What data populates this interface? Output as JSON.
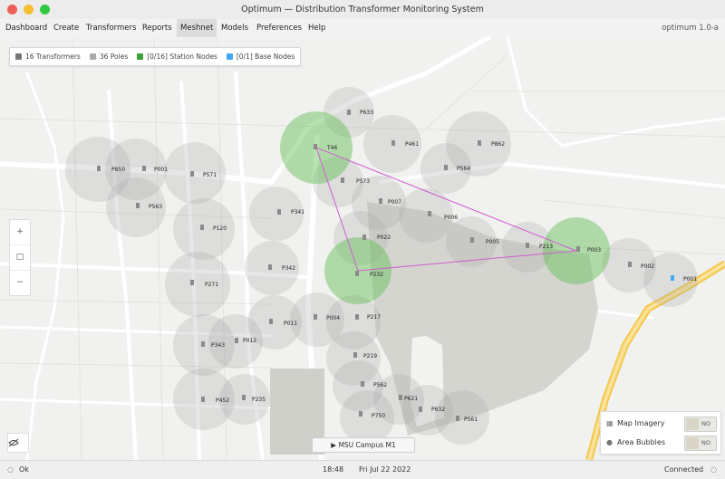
{
  "window": {
    "title": "Optimum — Distribution Transformer Monitoring System"
  },
  "menu": {
    "items": [
      {
        "label": "Dashboard"
      },
      {
        "label": "Create"
      },
      {
        "label": "Transformers"
      },
      {
        "label": "Reports"
      },
      {
        "label": "Meshnet"
      },
      {
        "label": "Models"
      },
      {
        "label": "Preferences"
      },
      {
        "label": "Help"
      }
    ],
    "active": "Meshnet",
    "version": "optimum 1.0-a"
  },
  "legend": {
    "transformers": "16 Transformers",
    "poles": "36 Poles",
    "station_nodes": "[0/16] Station Nodes",
    "base_nodes": "[0/1] Base Nodes",
    "colors": {
      "transformers": "#777777",
      "poles": "#aaaaaa",
      "station_nodes": "#3aa23a",
      "base_nodes": "#3fa9f5"
    }
  },
  "zoom": {
    "in": "+",
    "reset": "□",
    "out": "−"
  },
  "map": {
    "campus_label": "MSU Campus M1",
    "poles": [
      {
        "id": "P633"
      },
      {
        "id": "T46"
      },
      {
        "id": "P461"
      },
      {
        "id": "P862"
      },
      {
        "id": "P564"
      },
      {
        "id": "P850"
      },
      {
        "id": "P001"
      },
      {
        "id": "P571"
      },
      {
        "id": "P573"
      },
      {
        "id": "P563"
      },
      {
        "id": "P341"
      },
      {
        "id": "P007"
      },
      {
        "id": "P006"
      },
      {
        "id": "P120"
      },
      {
        "id": "P022"
      },
      {
        "id": "P005"
      },
      {
        "id": "P213"
      },
      {
        "id": "P003"
      },
      {
        "id": "P342"
      },
      {
        "id": "P232"
      },
      {
        "id": "P002"
      },
      {
        "id": "P001"
      },
      {
        "id": "P271"
      },
      {
        "id": "P011"
      },
      {
        "id": "P004"
      },
      {
        "id": "P217"
      },
      {
        "id": "P343"
      },
      {
        "id": "P012"
      },
      {
        "id": "P219"
      },
      {
        "id": "P562"
      },
      {
        "id": "P452"
      },
      {
        "id": "P235"
      },
      {
        "id": "P621"
      },
      {
        "id": "P632"
      },
      {
        "id": "P750"
      },
      {
        "id": "P561"
      }
    ]
  },
  "panel": {
    "map_imagery": {
      "label": "Map Imagery",
      "value": "NO"
    },
    "area_bubbles": {
      "label": "Area Bubbles",
      "value": "NO"
    }
  },
  "status": {
    "state": "Ok",
    "time": "18:48",
    "date": "Fri Jul 22 2022",
    "connection": "Connected"
  }
}
